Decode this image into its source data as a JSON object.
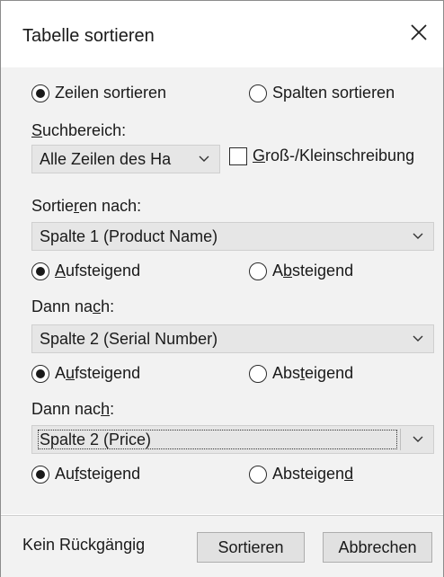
{
  "dialog": {
    "title": "Tabelle sortieren",
    "close_icon": "close-icon"
  },
  "orientation": {
    "rows": {
      "pre": "",
      "ul": "",
      "post": "Zeilen sortieren",
      "checked": true
    },
    "columns": {
      "pre": "",
      "ul": "",
      "post": "Spalten sortieren",
      "checked": false
    }
  },
  "search_range": {
    "label_pre": "",
    "label_ul": "S",
    "label_post": "uchbereich:",
    "value": "Alle Zeilen des Ha"
  },
  "case_sensitive": {
    "label_pre": "",
    "label_ul": "G",
    "label_post": "roß-/Kleinschreibung",
    "checked": false
  },
  "sort_by": {
    "label_pre": "Sortie",
    "label_ul": "r",
    "label_post": "en nach:",
    "value": "Spalte 1 (Product Name)",
    "asc": {
      "pre": "",
      "ul": "A",
      "post": "ufsteigend",
      "checked": true
    },
    "desc": {
      "pre": "A",
      "ul": "b",
      "post": "steigend",
      "checked": false
    }
  },
  "then_by_1": {
    "label_pre": "Dann na",
    "label_ul": "c",
    "label_post": "h:",
    "value": "Spalte 2 (Serial Number)",
    "asc": {
      "pre": "A",
      "ul": "u",
      "post": "fsteigend",
      "checked": true
    },
    "desc": {
      "pre": "Abs",
      "ul": "t",
      "post": "eigend",
      "checked": false
    }
  },
  "then_by_2": {
    "label_pre": "Dann nac",
    "label_ul": "h",
    "label_post": ":",
    "value": "Spalte 2 (Price)",
    "asc": {
      "pre": "Au",
      "ul": "f",
      "post": "steigend",
      "checked": true
    },
    "desc": {
      "pre": "Absteigen",
      "ul": "d",
      "post": "",
      "checked": false
    }
  },
  "footer": {
    "note": "Kein Rückgängig",
    "sort_button": "Sortieren",
    "cancel_button": "Abbrechen"
  },
  "icons": {
    "dropdown": "chevron-down-icon"
  }
}
